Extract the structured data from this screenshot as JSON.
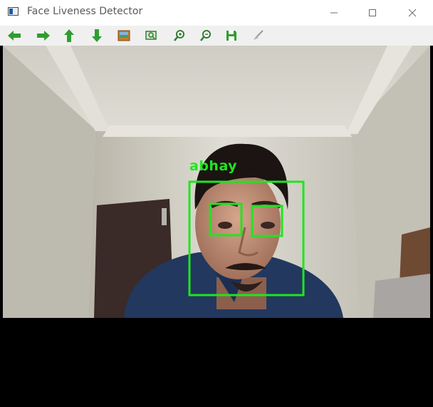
{
  "window": {
    "title": "Face Liveness Detector",
    "controls": [
      "minimize",
      "maximize",
      "close"
    ]
  },
  "toolbar": {
    "buttons": [
      {
        "icon": "arrow-left-icon",
        "tooltip": ""
      },
      {
        "icon": "arrow-right-icon",
        "tooltip": ""
      },
      {
        "icon": "arrow-up-icon",
        "tooltip": ""
      },
      {
        "icon": "arrow-down-icon",
        "tooltip": ""
      },
      {
        "icon": "image-icon",
        "tooltip": ""
      },
      {
        "icon": "zoom-fit-icon",
        "tooltip": ""
      },
      {
        "icon": "zoom-in-icon",
        "tooltip": ""
      },
      {
        "icon": "zoom-out-icon",
        "tooltip": ""
      },
      {
        "icon": "save-icon",
        "tooltip": ""
      },
      {
        "icon": "properties-brush-icon",
        "tooltip": ""
      }
    ]
  },
  "detection": {
    "label": "abhay",
    "box_color": "#1ee61e",
    "faces": 1,
    "eyes": 2
  },
  "colors": {
    "accent_green": "#1ee61e",
    "toolbar_arrow_green": "#2f9e2f",
    "letterbox": "#000000"
  }
}
